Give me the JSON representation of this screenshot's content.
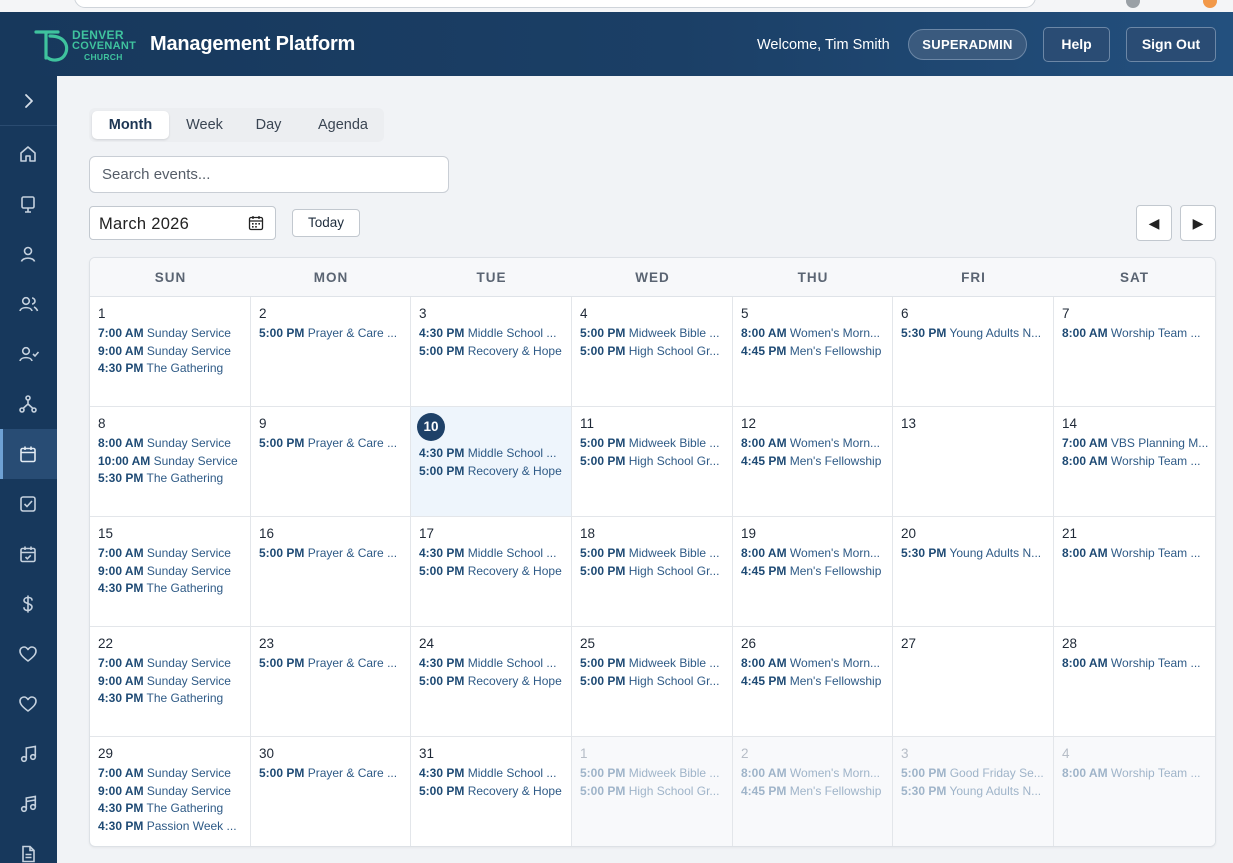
{
  "header": {
    "logo_lines": [
      "DENVER",
      "COVENANT",
      "CHURCH"
    ],
    "title": "Management Platform",
    "welcome": "Welcome, Tim Smith",
    "role": "SUPERADMIN",
    "help_label": "Help",
    "signout_label": "Sign Out"
  },
  "sidebar": {
    "toggle_icon": "chevron-right-icon",
    "items": [
      {
        "icon": "home-icon",
        "active": false
      },
      {
        "icon": "monitor-icon",
        "active": false
      },
      {
        "icon": "user-icon",
        "active": false
      },
      {
        "icon": "users-icon",
        "active": false
      },
      {
        "icon": "user-group-icon",
        "active": false
      },
      {
        "icon": "hierarchy-icon",
        "active": false
      },
      {
        "icon": "calendar-icon",
        "active": true
      },
      {
        "icon": "checkbox-icon",
        "active": false
      },
      {
        "icon": "calendar-check-icon",
        "active": false
      },
      {
        "icon": "dollar-icon",
        "active": false
      },
      {
        "icon": "heart-icon",
        "active": false
      },
      {
        "icon": "heart-outline-icon",
        "active": false
      },
      {
        "icon": "music-note-icon",
        "active": false
      },
      {
        "icon": "music-notes-icon",
        "active": false
      },
      {
        "icon": "document-icon",
        "active": false
      }
    ]
  },
  "view_tabs": [
    {
      "label": "Month",
      "active": true
    },
    {
      "label": "Week",
      "active": false
    },
    {
      "label": "Day",
      "active": false
    },
    {
      "label": "Agenda",
      "active": false
    }
  ],
  "search": {
    "placeholder": "Search events..."
  },
  "toolbar": {
    "month_value": "March 2026",
    "today_label": "Today",
    "prev_label": "◀",
    "next_label": "▶"
  },
  "calendar": {
    "weekdays": [
      "SUN",
      "MON",
      "TUE",
      "WED",
      "THU",
      "FRI",
      "SAT"
    ],
    "weeks": [
      [
        {
          "day": "1",
          "events": [
            {
              "time": "7:00 AM",
              "title": "Sunday Service"
            },
            {
              "time": "9:00 AM",
              "title": "Sunday Service"
            },
            {
              "time": "4:30 PM",
              "title": "The Gathering"
            }
          ]
        },
        {
          "day": "2",
          "events": [
            {
              "time": "5:00 PM",
              "title": "Prayer & Care ..."
            }
          ]
        },
        {
          "day": "3",
          "events": [
            {
              "time": "4:30 PM",
              "title": "Middle School ..."
            },
            {
              "time": "5:00 PM",
              "title": "Recovery & Hope"
            }
          ]
        },
        {
          "day": "4",
          "events": [
            {
              "time": "5:00 PM",
              "title": "Midweek Bible ..."
            },
            {
              "time": "5:00 PM",
              "title": "High School Gr..."
            }
          ]
        },
        {
          "day": "5",
          "events": [
            {
              "time": "8:00 AM",
              "title": "Women's Morn..."
            },
            {
              "time": "4:45 PM",
              "title": "Men's Fellowship"
            }
          ]
        },
        {
          "day": "6",
          "events": [
            {
              "time": "5:30 PM",
              "title": "Young Adults N..."
            }
          ]
        },
        {
          "day": "7",
          "events": [
            {
              "time": "8:00 AM",
              "title": "Worship Team ..."
            }
          ]
        }
      ],
      [
        {
          "day": "8",
          "events": [
            {
              "time": "8:00 AM",
              "title": "Sunday Service"
            },
            {
              "time": "10:00 AM",
              "title": "Sunday Service"
            },
            {
              "time": "5:30 PM",
              "title": "The Gathering"
            }
          ]
        },
        {
          "day": "9",
          "events": [
            {
              "time": "5:00 PM",
              "title": "Prayer & Care ..."
            }
          ]
        },
        {
          "day": "10",
          "today": true,
          "events": [
            {
              "time": "4:30 PM",
              "title": "Middle School ..."
            },
            {
              "time": "5:00 PM",
              "title": "Recovery & Hope"
            }
          ]
        },
        {
          "day": "11",
          "events": [
            {
              "time": "5:00 PM",
              "title": "Midweek Bible ..."
            },
            {
              "time": "5:00 PM",
              "title": "High School Gr..."
            }
          ]
        },
        {
          "day": "12",
          "events": [
            {
              "time": "8:00 AM",
              "title": "Women's Morn..."
            },
            {
              "time": "4:45 PM",
              "title": "Men's Fellowship"
            }
          ]
        },
        {
          "day": "13",
          "events": []
        },
        {
          "day": "14",
          "events": [
            {
              "time": "7:00 AM",
              "title": "VBS Planning M..."
            },
            {
              "time": "8:00 AM",
              "title": "Worship Team ..."
            }
          ]
        }
      ],
      [
        {
          "day": "15",
          "events": [
            {
              "time": "7:00 AM",
              "title": "Sunday Service"
            },
            {
              "time": "9:00 AM",
              "title": "Sunday Service"
            },
            {
              "time": "4:30 PM",
              "title": "The Gathering"
            }
          ]
        },
        {
          "day": "16",
          "events": [
            {
              "time": "5:00 PM",
              "title": "Prayer & Care ..."
            }
          ]
        },
        {
          "day": "17",
          "events": [
            {
              "time": "4:30 PM",
              "title": "Middle School ..."
            },
            {
              "time": "5:00 PM",
              "title": "Recovery & Hope"
            }
          ]
        },
        {
          "day": "18",
          "events": [
            {
              "time": "5:00 PM",
              "title": "Midweek Bible ..."
            },
            {
              "time": "5:00 PM",
              "title": "High School Gr..."
            }
          ]
        },
        {
          "day": "19",
          "events": [
            {
              "time": "8:00 AM",
              "title": "Women's Morn..."
            },
            {
              "time": "4:45 PM",
              "title": "Men's Fellowship"
            }
          ]
        },
        {
          "day": "20",
          "events": [
            {
              "time": "5:30 PM",
              "title": "Young Adults N..."
            }
          ]
        },
        {
          "day": "21",
          "events": [
            {
              "time": "8:00 AM",
              "title": "Worship Team ..."
            }
          ]
        }
      ],
      [
        {
          "day": "22",
          "events": [
            {
              "time": "7:00 AM",
              "title": "Sunday Service"
            },
            {
              "time": "9:00 AM",
              "title": "Sunday Service"
            },
            {
              "time": "4:30 PM",
              "title": "The Gathering"
            }
          ]
        },
        {
          "day": "23",
          "events": [
            {
              "time": "5:00 PM",
              "title": "Prayer & Care ..."
            }
          ]
        },
        {
          "day": "24",
          "events": [
            {
              "time": "4:30 PM",
              "title": "Middle School ..."
            },
            {
              "time": "5:00 PM",
              "title": "Recovery & Hope"
            }
          ]
        },
        {
          "day": "25",
          "events": [
            {
              "time": "5:00 PM",
              "title": "Midweek Bible ..."
            },
            {
              "time": "5:00 PM",
              "title": "High School Gr..."
            }
          ]
        },
        {
          "day": "26",
          "events": [
            {
              "time": "8:00 AM",
              "title": "Women's Morn..."
            },
            {
              "time": "4:45 PM",
              "title": "Men's Fellowship"
            }
          ]
        },
        {
          "day": "27",
          "events": []
        },
        {
          "day": "28",
          "events": [
            {
              "time": "8:00 AM",
              "title": "Worship Team ..."
            }
          ]
        }
      ],
      [
        {
          "day": "29",
          "events": [
            {
              "time": "7:00 AM",
              "title": "Sunday Service"
            },
            {
              "time": "9:00 AM",
              "title": "Sunday Service"
            },
            {
              "time": "4:30 PM",
              "title": "The Gathering"
            },
            {
              "time": "4:30 PM",
              "title": "Passion Week ..."
            }
          ]
        },
        {
          "day": "30",
          "events": [
            {
              "time": "5:00 PM",
              "title": "Prayer & Care ..."
            }
          ]
        },
        {
          "day": "31",
          "events": [
            {
              "time": "4:30 PM",
              "title": "Middle School ..."
            },
            {
              "time": "5:00 PM",
              "title": "Recovery & Hope"
            }
          ]
        },
        {
          "day": "1",
          "other_month": true,
          "events": [
            {
              "time": "5:00 PM",
              "title": "Midweek Bible ..."
            },
            {
              "time": "5:00 PM",
              "title": "High School Gr..."
            }
          ]
        },
        {
          "day": "2",
          "other_month": true,
          "events": [
            {
              "time": "8:00 AM",
              "title": "Women's Morn..."
            },
            {
              "time": "4:45 PM",
              "title": "Men's Fellowship"
            }
          ]
        },
        {
          "day": "3",
          "other_month": true,
          "events": [
            {
              "time": "5:00 PM",
              "title": "Good Friday Se..."
            },
            {
              "time": "5:30 PM",
              "title": "Young Adults N..."
            }
          ]
        },
        {
          "day": "4",
          "other_month": true,
          "events": [
            {
              "time": "8:00 AM",
              "title": "Worship Team ..."
            }
          ]
        }
      ]
    ]
  },
  "colors": {
    "header_bg": "#1b3f66",
    "sidebar_bg": "#17385c",
    "accent": "#1e4168",
    "event_time": "#1e4a74",
    "today_cell": "#eef5fc",
    "logo_green": "#3fc39e"
  }
}
